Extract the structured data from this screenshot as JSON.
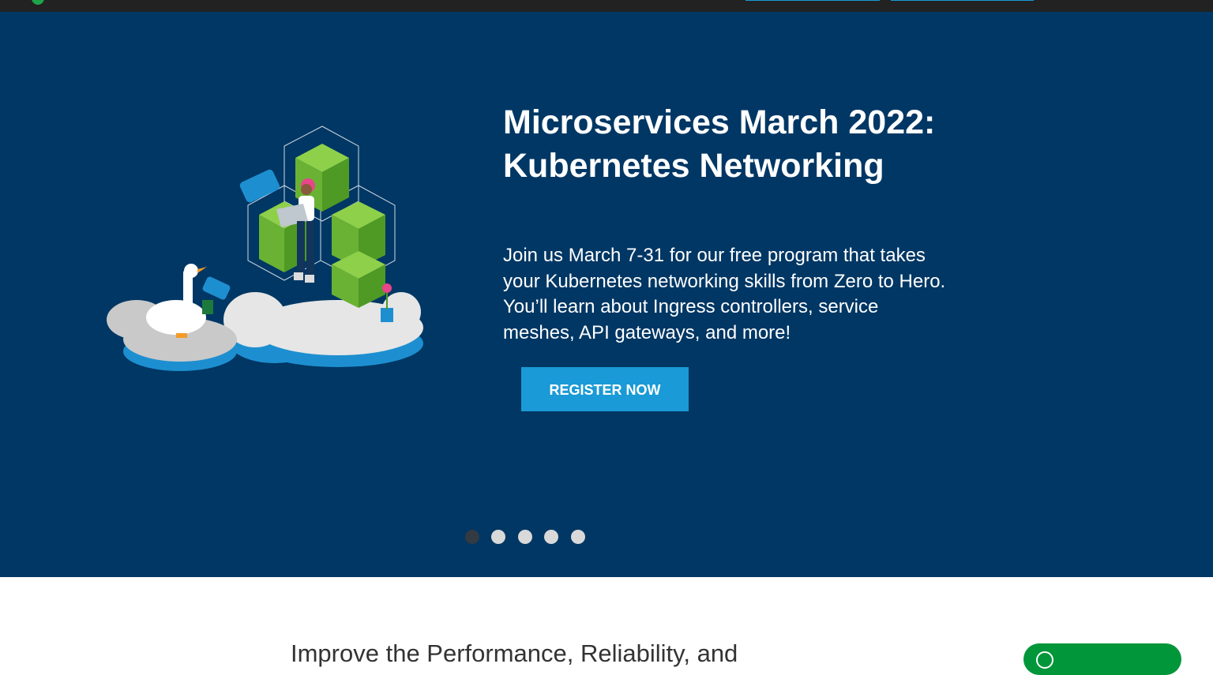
{
  "hero": {
    "title_line1": "Microservices March 2022:",
    "title_line2": "Kubernetes Networking",
    "body_line1": "Join us March 7-31 for our free program that takes",
    "body_line2": "your Kubernetes networking skills from Zero to Hero.",
    "body_line3": "You’ll learn about Ingress controllers, service",
    "body_line4": "meshes, API gateways, and more!",
    "cta_label": "REGISTER NOW",
    "art_icon": "kubernetes-networking-illustration",
    "background_color": "#003764"
  },
  "carousel": {
    "slides": 5,
    "active_index": 0
  },
  "below": {
    "heading": "Improve the Performance, Reliability, and"
  },
  "colors": {
    "accent": "#1a9ad6",
    "brand_green": "#009639",
    "topbar": "#222222"
  }
}
